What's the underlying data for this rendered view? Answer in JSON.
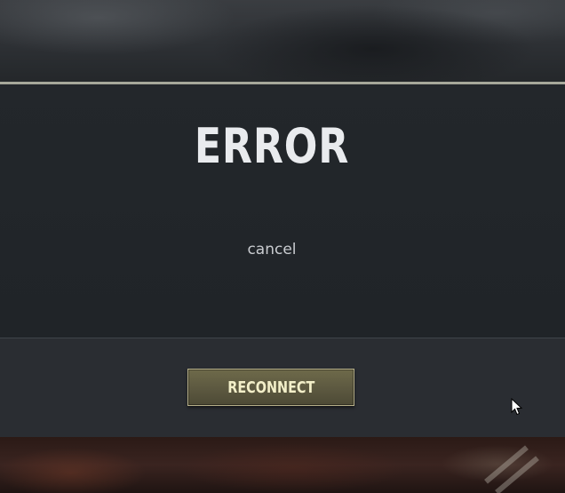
{
  "dialog": {
    "title": "ERROR",
    "message": "cancel",
    "reconnect_label": "RECONNECT"
  },
  "colors": {
    "accent_border": "#a6a89a",
    "button_fill": "#5c5840",
    "button_text": "#f3efc9",
    "dialog_bg": "#22262a",
    "footer_bg": "#2a2d32"
  },
  "icons": {
    "cursor": "mouse-pointer-icon"
  }
}
